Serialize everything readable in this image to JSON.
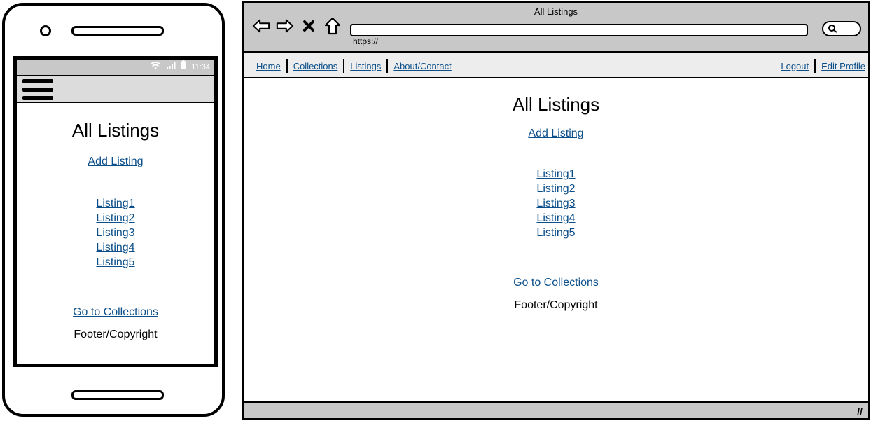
{
  "mobile": {
    "status": {
      "time": "11:34"
    },
    "title": "All Listings",
    "add_listing": "Add Listing",
    "listings": [
      "Listing1",
      "Listing2",
      "Listing3",
      "Listing4",
      "Listing5"
    ],
    "go_to_collections": "Go to Collections",
    "footer": "Footer/Copyright"
  },
  "browser": {
    "window_title": "All Listings",
    "url": "https://",
    "nav_left": [
      "Home",
      "Collections",
      "Listings",
      "About/Contact"
    ],
    "nav_right": [
      "Logout",
      "Edit Profile"
    ],
    "title": "All Listings",
    "add_listing": "Add Listing",
    "listings": [
      "Listing1",
      "Listing2",
      "Listing3",
      "Listing4",
      "Listing5"
    ],
    "go_to_collections": "Go to Collections",
    "footer": "Footer/Copyright"
  },
  "icons": {
    "back": "back-arrow-icon",
    "forward": "forward-arrow-icon",
    "close": "close-icon",
    "home": "home-icon",
    "search": "search-icon",
    "menu": "hamburger-menu-icon"
  },
  "colors": {
    "link": "#0b4f8a",
    "chrome": "#c8c8c8"
  }
}
